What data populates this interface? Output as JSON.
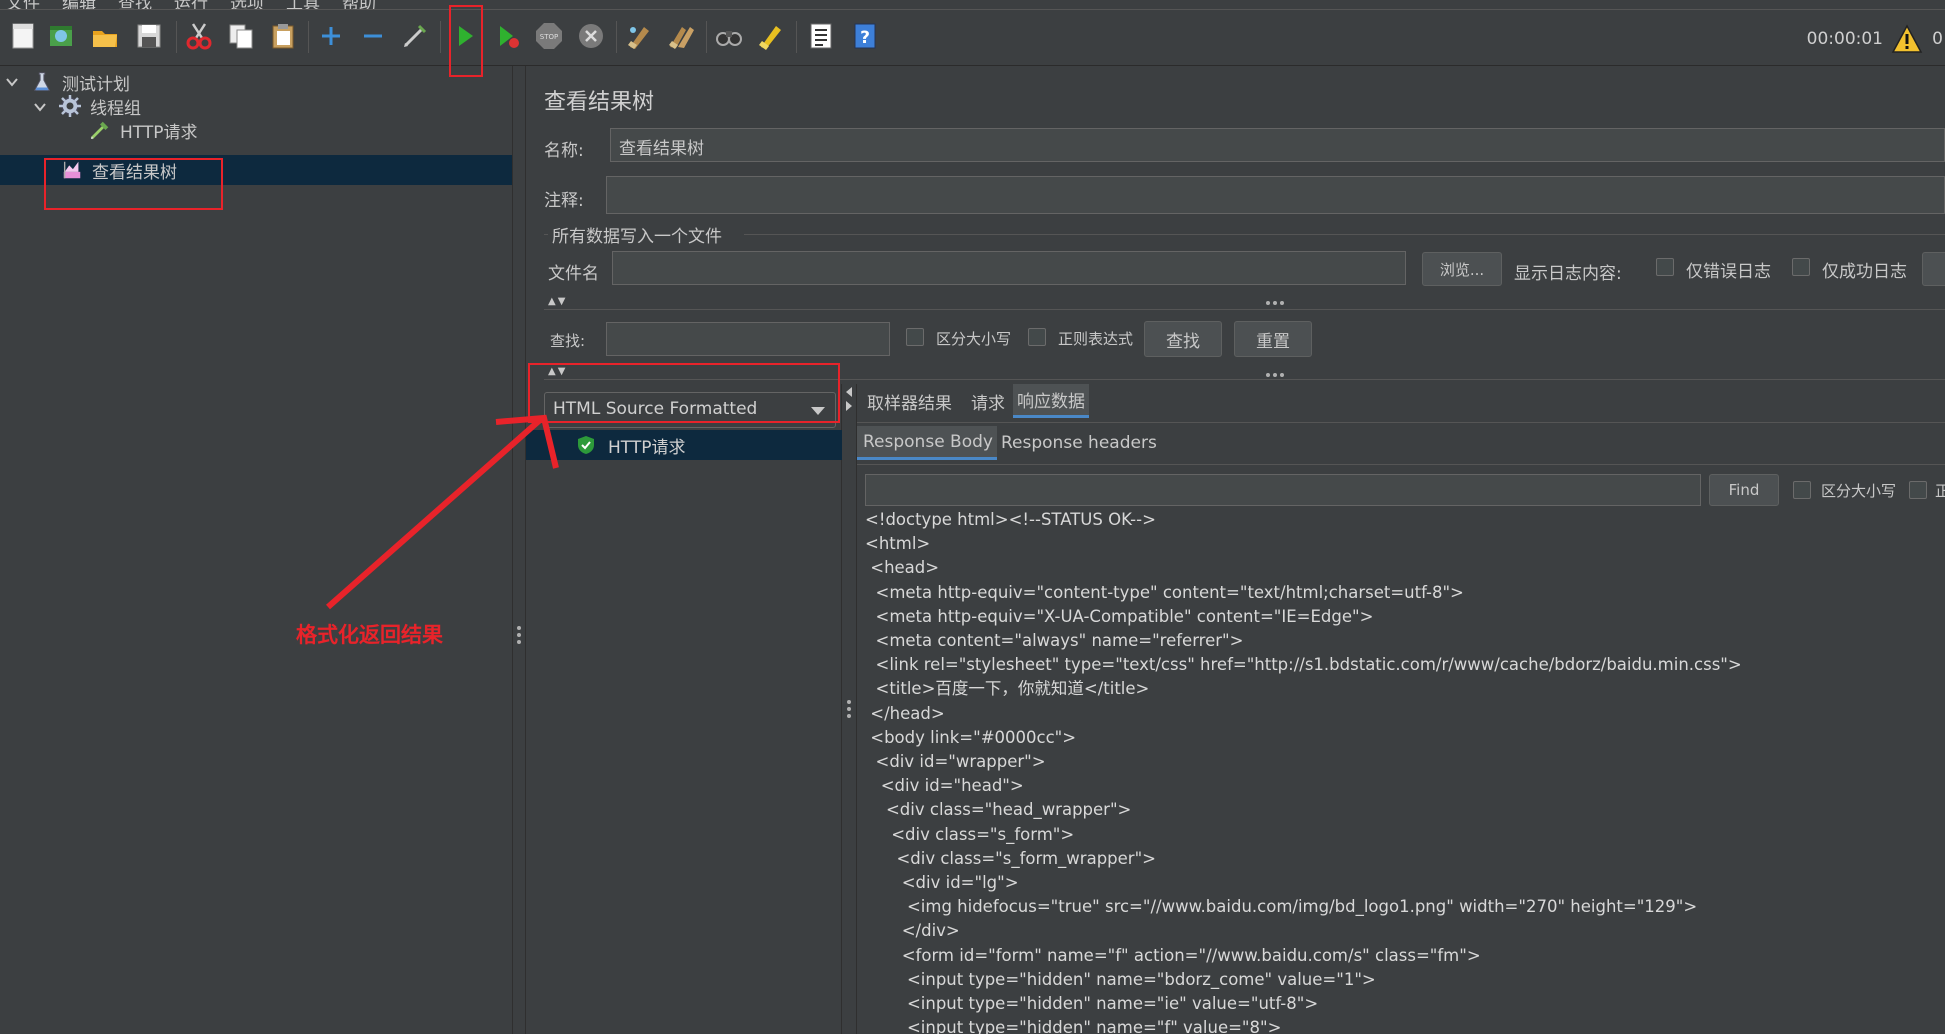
{
  "menubar": {
    "items": [
      "文件",
      "编辑",
      "查找",
      "运行",
      "选项",
      "工具",
      "帮助"
    ]
  },
  "toolbar": {
    "icons": [
      "new-icon",
      "templates-icon",
      "open-icon",
      "save-icon",
      "cut-icon",
      "copy-icon",
      "paste-icon",
      "expand-icon",
      "collapse-icon",
      "toggle-icon",
      "start-icon",
      "start-no-pause-icon",
      "stop-icon",
      "shutdown-icon",
      "clear-icon",
      "clear-all-icon",
      "search-icon",
      "reset-search-icon",
      "function-helper-icon",
      "help-icon"
    ],
    "timer": "00:00:01",
    "warning_count": "0"
  },
  "tree": {
    "nodes": [
      {
        "label": "测试计划",
        "icon": "test-plan-icon"
      },
      {
        "label": "线程组",
        "icon": "thread-group-icon"
      },
      {
        "label": "HTTP请求",
        "icon": "http-sampler-icon"
      },
      {
        "label": "查看结果树",
        "icon": "results-tree-icon"
      }
    ]
  },
  "panel": {
    "title": "查看结果树",
    "name_label": "名称:",
    "name_value": "查看结果树",
    "comment_label": "注释:",
    "comment_value": "",
    "file_section_title": "所有数据写入一个文件",
    "file_label": "文件名",
    "file_value": "",
    "browse_button": "浏览...",
    "log_content_label": "显示日志内容:",
    "errors_only_label": "仅错误日志",
    "success_only_label": "仅成功日志",
    "search_label": "查找:",
    "search_value": "",
    "case_sensitive_label": "区分大小写",
    "regex_label": "正则表达式",
    "find_button": "查找",
    "reset_button": "重置"
  },
  "results": {
    "renderer": "HTML Source Formatted",
    "samples": [
      "HTTP请求"
    ],
    "tabs": [
      "取样器结果",
      "请求",
      "响应数据"
    ],
    "active_tab": "响应数据",
    "subtabs": [
      "Response Body",
      "Response headers"
    ],
    "active_subtab": "Response Body",
    "find_button": "Find",
    "find_case_label": "区分大小写",
    "find_regex_label": "正",
    "body_lines": [
      "<!doctype html><!--STATUS OK-->",
      "<html>",
      " <head>",
      "  <meta http-equiv=\"content-type\" content=\"text/html;charset=utf-8\">",
      "  <meta http-equiv=\"X-UA-Compatible\" content=\"IE=Edge\">",
      "  <meta content=\"always\" name=\"referrer\">",
      "  <link rel=\"stylesheet\" type=\"text/css\" href=\"http://s1.bdstatic.com/r/www/cache/bdorz/baidu.min.css\">",
      "  <title>百度一下，你就知道</title>",
      " </head>",
      " <body link=\"#0000cc\">",
      "  <div id=\"wrapper\">",
      "   <div id=\"head\">",
      "    <div class=\"head_wrapper\">",
      "     <div class=\"s_form\">",
      "      <div class=\"s_form_wrapper\">",
      "       <div id=\"lg\">",
      "        <img hidefocus=\"true\" src=\"//www.baidu.com/img/bd_logo1.png\" width=\"270\" height=\"129\">",
      "       </div>",
      "       <form id=\"form\" name=\"f\" action=\"//www.baidu.com/s\" class=\"fm\">",
      "        <input type=\"hidden\" name=\"bdorz_come\" value=\"1\">",
      "        <input type=\"hidden\" name=\"ie\" value=\"utf-8\">",
      "        <input type=\"hidden\" name=\"f\" value=\"8\">"
    ]
  },
  "annotation": {
    "text": "格式化返回结果",
    "color": "#e8232a"
  }
}
